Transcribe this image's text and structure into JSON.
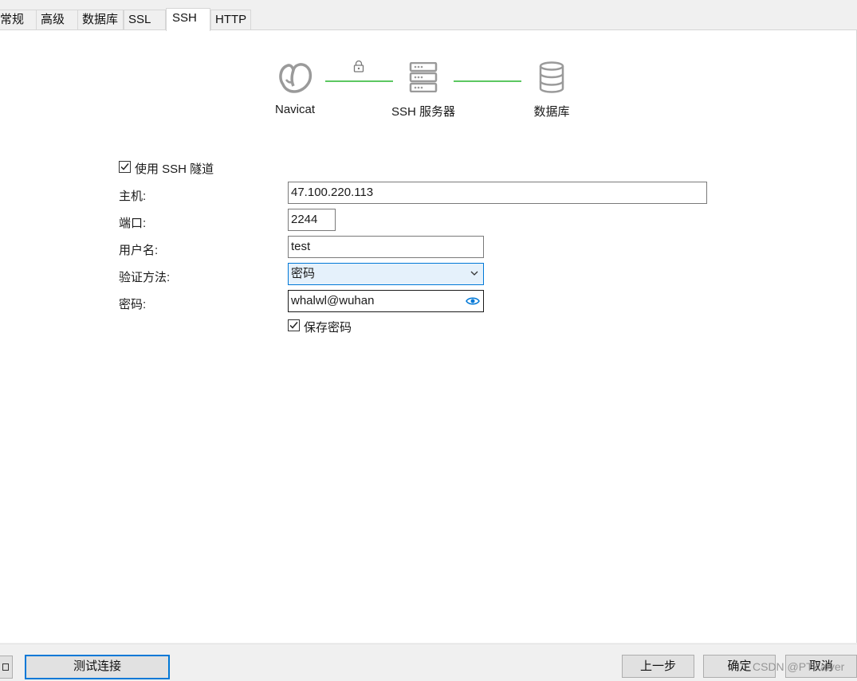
{
  "tabs": [
    "常规",
    "高级",
    "数据库",
    "SSL",
    "SSH",
    "HTTP"
  ],
  "active_tab": "SSH",
  "diagram": {
    "navicat_label": "Navicat",
    "ssh_label": "SSH 服务器",
    "db_label": "数据库",
    "line_color": "#5cc761"
  },
  "form": {
    "use_ssh_label": "使用 SSH 隧道",
    "use_ssh_checked": true,
    "host_label": "主机:",
    "host_value": "47.100.220.113",
    "port_label": "端口:",
    "port_value": "2244",
    "user_label": "用户名:",
    "user_value": "test",
    "auth_label": "验证方法:",
    "auth_value": "密码",
    "password_label": "密码:",
    "password_value": "whalwl@wuhan",
    "save_password_label": "保存密码",
    "save_password_checked": true
  },
  "footer": {
    "test_button": "测试连接",
    "prev_button": "上一步",
    "ok_button": "确定",
    "cancel_button": "取消",
    "watermark": "CSDN @PTKaiver"
  },
  "colors": {
    "accent": "#0078d7",
    "eye_icon": "#0078d7",
    "select_bg": "#e5f1fb"
  }
}
